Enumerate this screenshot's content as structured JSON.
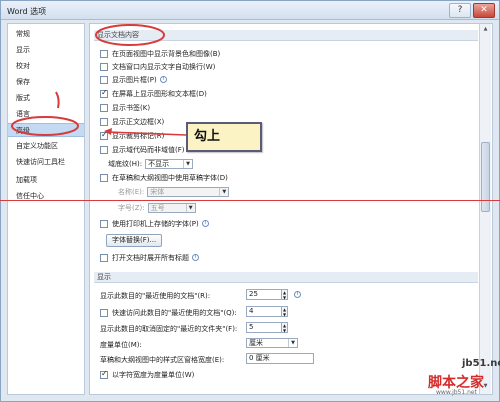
{
  "window": {
    "title": "Word 选项"
  },
  "controls": {
    "help": "?",
    "close": "✕"
  },
  "sidebar": {
    "items": [
      {
        "label": "常规"
      },
      {
        "label": "显示"
      },
      {
        "label": "校对"
      },
      {
        "label": "保存"
      },
      {
        "label": "版式"
      },
      {
        "label": "语言"
      },
      {
        "label": "高级"
      },
      {
        "label": "自定义功能区"
      },
      {
        "label": "快速访问工具栏"
      },
      {
        "label": "加载项"
      },
      {
        "label": "信任中心"
      }
    ],
    "selected_index": 6
  },
  "doc_content": {
    "header": "显示文档内容",
    "options": [
      {
        "label": "在页面视图中显示背景色和图像(B)",
        "checked": false
      },
      {
        "label": "文档窗口内显示文字自动换行(W)",
        "checked": false
      },
      {
        "label": "显示图片框(P)",
        "checked": false
      },
      {
        "label": "在屏幕上显示图形和文本框(D)",
        "checked": true
      },
      {
        "label": "显示书签(K)",
        "checked": false
      },
      {
        "label": "显示正文边框(X)",
        "checked": false
      },
      {
        "label": "显示裁剪标记(R)",
        "checked": true
      },
      {
        "label": "显示域代码而非域值(F)",
        "checked": false
      }
    ],
    "field_shading_label": "域底纹(H):",
    "field_shading_value": "不显示",
    "draft_font_label": "在草稿和大纲视图中使用草稿字体(D)",
    "name_label": "名称(E):",
    "name_value": "宋体",
    "size_label": "字号(Z):",
    "size_value": "五号",
    "printer_fonts_label": "使用打印机上存储的字体(P)",
    "font_sub_button": "字体替换(F)...",
    "expand_headings_label": "打开文档时展开所有标题"
  },
  "display": {
    "header": "显示",
    "recent_docs_label": "显示此数目的\"最近使用的文档\"(R):",
    "recent_docs_value": "25",
    "quick_access_label": "快速访问此数目的\"最近使用的文档\"(Q):",
    "quick_access_value": "4",
    "unpinned_label": "显示此数目的取消固定的\"最近的文件夹\"(F):",
    "unpinned_value": "5",
    "units_label": "度量单位(M):",
    "units_value": "厘米",
    "pane_width_label": "草稿和大纲视图中的样式区窗格宽度(E):",
    "pane_width_value": "0 厘米",
    "char_width_label": "以字符宽度为度量单位(W)"
  },
  "callout": {
    "text": "勾上"
  },
  "watermark": {
    "site": "jb51.net",
    "brand": "脚本之家",
    "url": "www.jb51.net"
  },
  "colors": {
    "annotation_red": "#d83b3b",
    "callout_bg": "#fbf3c3",
    "selected_nav": "#c4daf3"
  }
}
